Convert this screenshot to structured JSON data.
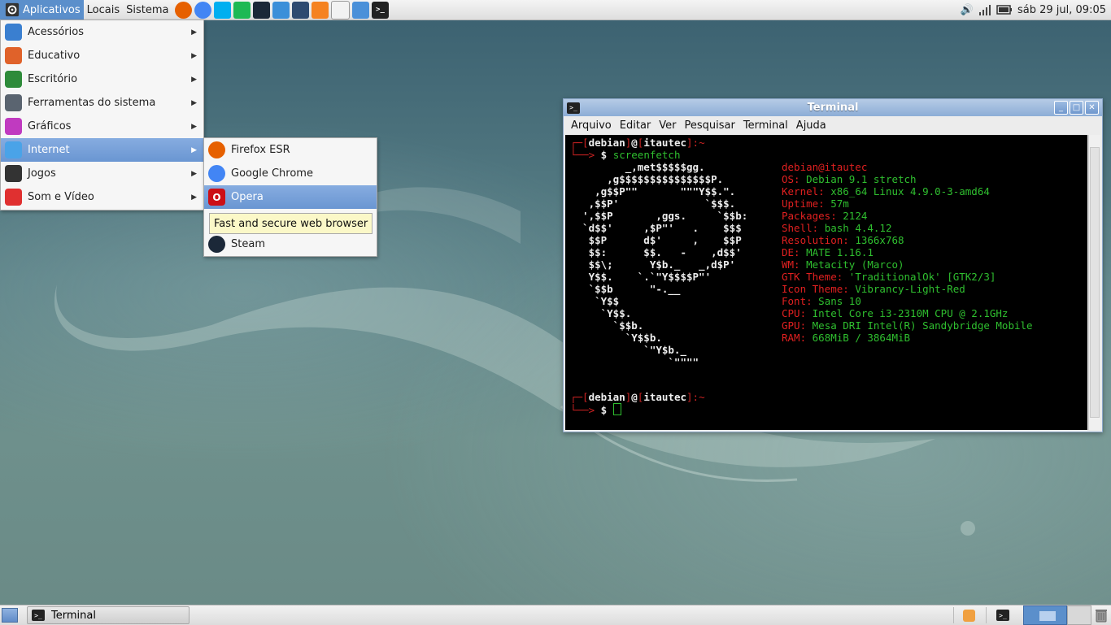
{
  "top_panel": {
    "menus": [
      "Aplicativos",
      "Locais",
      "Sistema"
    ],
    "launchers": [
      {
        "icon": "firefox-icon",
        "color": "#e66000"
      },
      {
        "icon": "chrome-icon",
        "color": "#4285f4"
      },
      {
        "icon": "skype-icon",
        "color": "#00aff0"
      },
      {
        "icon": "spotify-icon",
        "color": "#1db954"
      },
      {
        "icon": "steam-icon",
        "color": "#1b2838"
      },
      {
        "icon": "wps-writer-icon",
        "color": "#3b8fd9"
      },
      {
        "icon": "camera-icon",
        "color": "#2e4a70"
      },
      {
        "icon": "media-player-icon",
        "color": "#f58220"
      },
      {
        "icon": "text-editor-icon",
        "color": "#f2f2f2"
      },
      {
        "icon": "downloader-icon",
        "color": "#4a90d9"
      },
      {
        "icon": "terminal-icon",
        "color": "#222222"
      }
    ],
    "clock": "sáb 29 jul, 09:05"
  },
  "app_menu": {
    "items": [
      {
        "label": "Acessórios",
        "icon": "accessories-icon",
        "color": "#3a7fd0"
      },
      {
        "label": "Educativo",
        "icon": "education-icon",
        "color": "#e0622a"
      },
      {
        "label": "Escritório",
        "icon": "office-icon",
        "color": "#2e8b3a"
      },
      {
        "label": "Ferramentas do sistema",
        "icon": "system-tools-icon",
        "color": "#5a6470"
      },
      {
        "label": "Gráficos",
        "icon": "graphics-icon",
        "color": "#c03ac0"
      },
      {
        "label": "Internet",
        "icon": "internet-icon",
        "color": "#4aa3e8"
      },
      {
        "label": "Jogos",
        "icon": "games-icon",
        "color": "#333333"
      },
      {
        "label": "Som e Vídeo",
        "icon": "multimedia-icon",
        "color": "#e03030"
      }
    ]
  },
  "internet_submenu": {
    "items": [
      {
        "label": "Firefox ESR",
        "icon": "firefox-icon"
      },
      {
        "label": "Google Chrome",
        "icon": "chrome-icon"
      },
      {
        "label": "Opera",
        "icon": "opera-icon"
      },
      {
        "label": "Steam",
        "icon": "steam-icon"
      }
    ],
    "tooltip": "Fast and secure web browser"
  },
  "terminal": {
    "title": "Terminal",
    "menus": [
      "Arquivo",
      "Editar",
      "Ver",
      "Pesquisar",
      "Terminal",
      "Ajuda"
    ],
    "command": "screenfetch",
    "prompt_user": "debian",
    "prompt_host": "itautec",
    "logo_lines": [
      "         _,met$$$$$gg.",
      "      ,g$$$$$$$$$$$$$$$P.",
      "    ,g$$P\"\"       \"\"\"Y$$.\".",
      "   ,$$P'              `$$$.",
      "  ',$$P       ,ggs.     `$$b:",
      "  `d$$'     ,$P\"'   .    $$$",
      "   $$P      d$'     ,    $$P",
      "   $$:      $$.   -    ,d$$'",
      "   $$\\;      Y$b._   _,d$P'",
      "   Y$$.    `.`\"Y$$$$P\"'",
      "   `$$b      \"-.__",
      "    `Y$$",
      "     `Y$$.",
      "       `$$b.",
      "         `Y$$b.",
      "            `\"Y$b._",
      "                `\"\"\"\""
    ],
    "header": "debian@itautec",
    "info": [
      {
        "key": "OS:",
        "value": "Debian 9.1 stretch"
      },
      {
        "key": "Kernel:",
        "value": "x86_64 Linux 4.9.0-3-amd64"
      },
      {
        "key": "Uptime:",
        "value": "57m"
      },
      {
        "key": "Packages:",
        "value": "2124"
      },
      {
        "key": "Shell:",
        "value": "bash 4.4.12"
      },
      {
        "key": "Resolution:",
        "value": "1366x768"
      },
      {
        "key": "DE:",
        "value": "MATE 1.16.1"
      },
      {
        "key": "WM:",
        "value": "Metacity (Marco)"
      },
      {
        "key": "GTK Theme:",
        "value": "'TraditionalOk' [GTK2/3]"
      },
      {
        "key": "Icon Theme:",
        "value": "Vibrancy-Light-Red"
      },
      {
        "key": "Font:",
        "value": "Sans 10"
      },
      {
        "key": "CPU:",
        "value": "Intel Core i3-2310M CPU @ 2.1GHz"
      },
      {
        "key": "GPU:",
        "value": "Mesa DRI Intel(R) Sandybridge Mobile"
      },
      {
        "key": "RAM:",
        "value": "668MiB / 3864MiB"
      }
    ]
  },
  "bottom_panel": {
    "task_label": "Terminal"
  }
}
